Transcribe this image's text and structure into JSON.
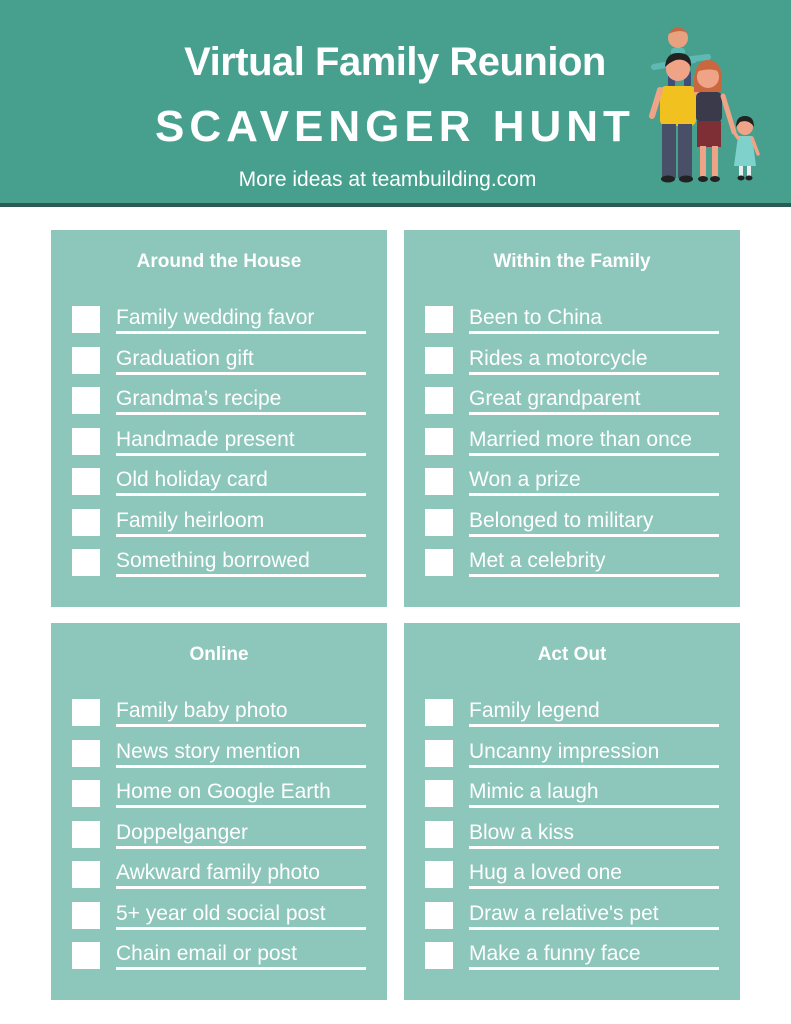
{
  "header": {
    "title": "Virtual Family Reunion",
    "subtitle": "SCAVENGER HUNT",
    "tagline": "More ideas at teambuilding.com",
    "illustration": "family-illustration",
    "colors": {
      "header_bg": "#47a08e",
      "stripe": "#2e5a54",
      "panel_bg": "#8dc6ba",
      "text": "#ffffff"
    }
  },
  "sections": [
    {
      "title": "Around the House",
      "items": [
        {
          "label": "Family wedding favor",
          "checked": false
        },
        {
          "label": "Graduation gift",
          "checked": false
        },
        {
          "label": "Grandma’s recipe",
          "checked": false
        },
        {
          "label": "Handmade present",
          "checked": false
        },
        {
          "label": "Old holiday card",
          "checked": false
        },
        {
          "label": "Family heirloom",
          "checked": false
        },
        {
          "label": "Something borrowed",
          "checked": false
        }
      ]
    },
    {
      "title": "Within the Family",
      "items": [
        {
          "label": "Been to China",
          "checked": false
        },
        {
          "label": "Rides a motorcycle",
          "checked": false
        },
        {
          "label": "Great grandparent",
          "checked": false
        },
        {
          "label": "Married more than once",
          "checked": false
        },
        {
          "label": "Won a prize",
          "checked": false
        },
        {
          "label": "Belonged to military",
          "checked": false
        },
        {
          "label": "Met a celebrity",
          "checked": false
        }
      ]
    },
    {
      "title": "Online",
      "items": [
        {
          "label": "Family baby photo",
          "checked": false
        },
        {
          "label": "News story mention",
          "checked": false
        },
        {
          "label": "Home on Google Earth",
          "checked": false
        },
        {
          "label": "Doppelganger",
          "checked": false
        },
        {
          "label": "Awkward family photo",
          "checked": false
        },
        {
          "label": "5+ year old social post",
          "checked": false
        },
        {
          "label": "Chain email or post",
          "checked": false
        }
      ]
    },
    {
      "title": "Act Out",
      "items": [
        {
          "label": "Family legend",
          "checked": false
        },
        {
          "label": "Uncanny impression",
          "checked": false
        },
        {
          "label": "Mimic a laugh",
          "checked": false
        },
        {
          "label": "Blow a kiss",
          "checked": false
        },
        {
          "label": "Hug a loved one",
          "checked": false
        },
        {
          "label": "Draw a relative's pet",
          "checked": false
        },
        {
          "label": "Make a funny face",
          "checked": false
        }
      ]
    }
  ]
}
